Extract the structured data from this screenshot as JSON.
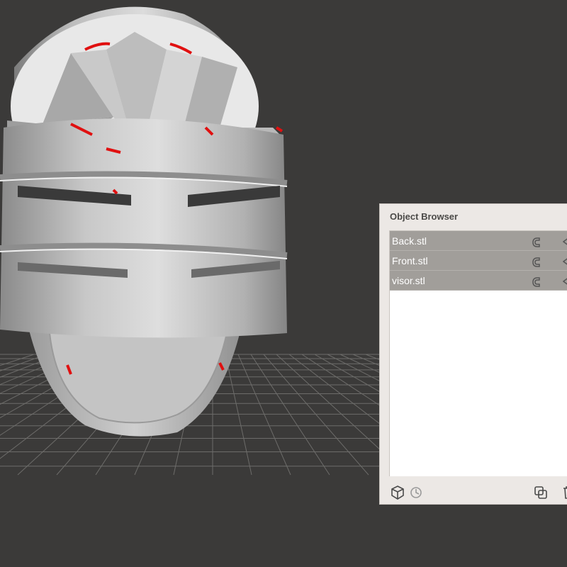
{
  "object_browser": {
    "title": "Object Browser",
    "items": [
      {
        "label": "Back.stl"
      },
      {
        "label": "Front.stl"
      },
      {
        "label": "visor.stl"
      }
    ],
    "footer_icons": [
      "cube-icon",
      "clock-reset-icon",
      "duplicate-icon",
      "trash-icon"
    ]
  },
  "viewport": {
    "background": "#3b3a39",
    "grid_color": "#6d6c6a",
    "model_color": "#d2d2d2",
    "highlight_color": "#e01010"
  }
}
